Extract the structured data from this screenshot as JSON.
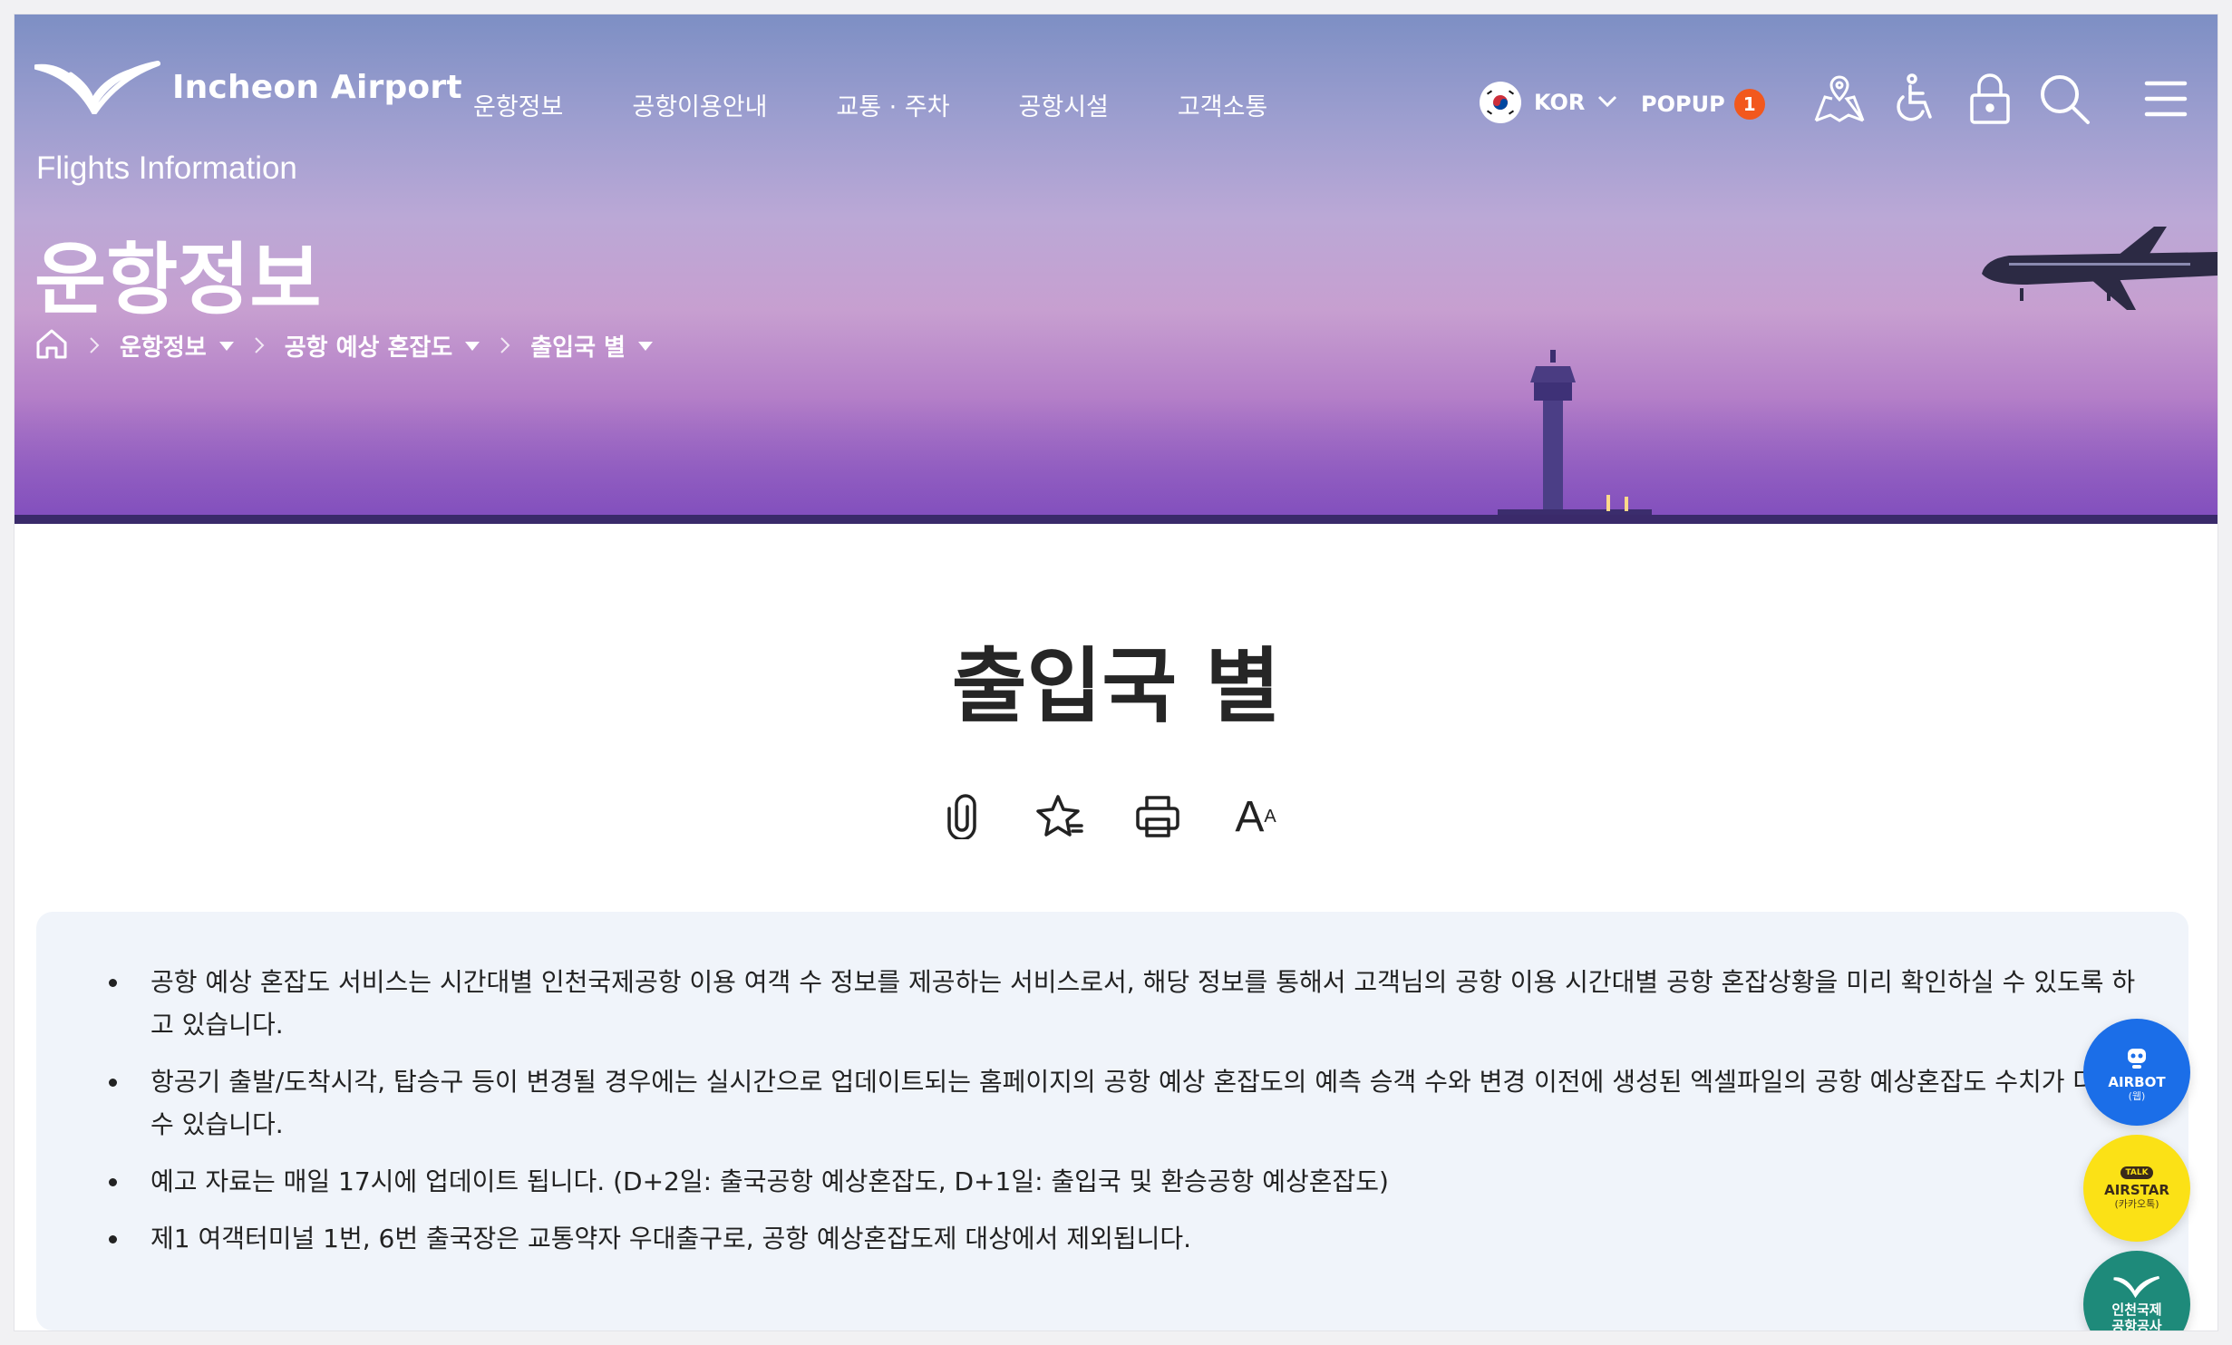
{
  "header": {
    "logo_text": "Incheon Airport",
    "nav": [
      "운항정보",
      "공항이용안내",
      "교통 · 주차",
      "공항시설",
      "고객소통"
    ],
    "language": {
      "label": "KOR"
    },
    "popup": {
      "label": "POPUP",
      "count": "1"
    },
    "utilities": [
      "map-icon",
      "accessibility-icon",
      "lock-icon",
      "search-icon",
      "menu-icon"
    ]
  },
  "hero": {
    "subtitle": "Flights Information",
    "title": "운항정보",
    "breadcrumb": [
      "운항정보",
      "공항 예상 혼잡도",
      "출입국 별"
    ]
  },
  "content": {
    "title": "출입국 별",
    "tools": [
      "clip-icon",
      "favorite-star-icon",
      "print-icon",
      "font-size-icon"
    ],
    "font_tool_label": "A",
    "font_tool_small": "A",
    "notices": [
      "공항 예상 혼잡도 서비스는 시간대별 인천국제공항 이용 여객 수 정보를 제공하는 서비스로서, 해당 정보를 통해서 고객님의 공항 이용 시간대별 공항 혼잡상황을 미리 확인하실 수 있도록 하고 있습니다.",
      "항공기 출발/도착시각, 탑승구 등이 변경될 경우에는 실시간으로 업데이트되는 홈페이지의 공항 예상 혼잡도의 예측 승객 수와 변경 이전에 생성된 엑셀파일의 공항 예상혼잡도 수치가 다를 수 있습니다.",
      "예고 자료는 매일 17시에 업데이트 됩니다. (D+2일: 출국공항 예상혼잡도, D+1일: 출입국 및 환승공항 예상혼잡도)",
      "제1 여객터미널 1번, 6번 출국장은 교통약자 우대출구로, 공항 예상혼잡도제 대상에서 제외됩니다."
    ]
  },
  "floating": {
    "airbot": {
      "label": "AIRBOT",
      "sub": "(웹)"
    },
    "airstar": {
      "top": "TALK",
      "label": "AIRSTAR",
      "sub": "(카카오톡)"
    },
    "corp": {
      "label": "인천국제",
      "sub": "공항공사"
    }
  },
  "colors": {
    "popup_badge": "#f2581d",
    "airbot": "#1b6ee8",
    "airstar": "#fbe116",
    "corp": "#1e8a7a",
    "notice_bg": "#f0f4fa"
  }
}
